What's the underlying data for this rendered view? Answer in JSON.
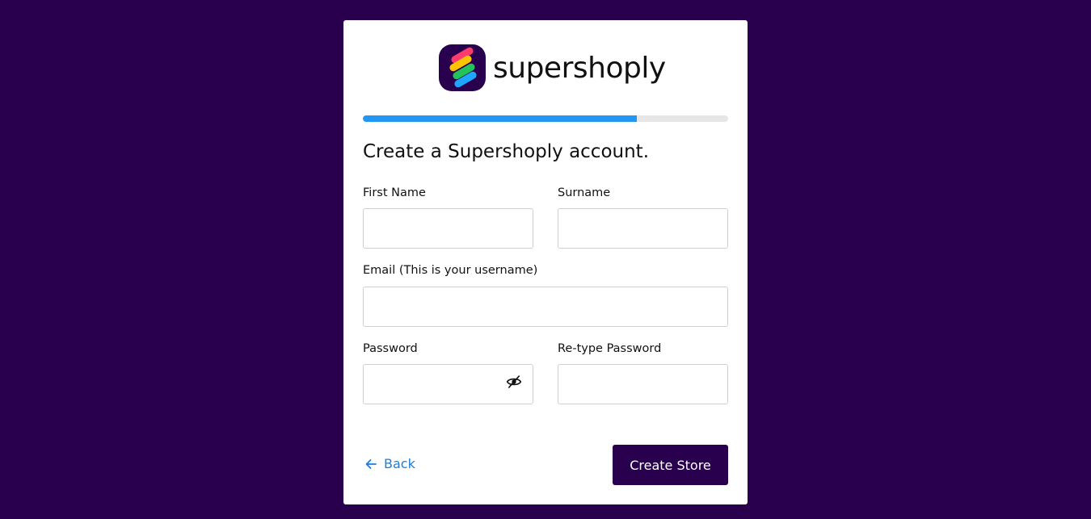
{
  "brand": {
    "name": "supershoply",
    "icon": "supershoply-logo-icon",
    "mark_color": "#28004d",
    "stripe_colors": [
      "#ff3b6b",
      "#ffc400",
      "#21c45a",
      "#1ea7ff"
    ]
  },
  "progress": {
    "fraction": 0.75,
    "fill_color": "#2196f3",
    "track_color": "#e6e6e6"
  },
  "form": {
    "title": "Create a Supershoply account.",
    "first_name": {
      "label": "First Name",
      "value": "",
      "placeholder": ""
    },
    "surname": {
      "label": "Surname",
      "value": "",
      "placeholder": ""
    },
    "email": {
      "label": "Email (This is your username)",
      "value": "",
      "placeholder": ""
    },
    "password": {
      "label": "Password",
      "value": "",
      "placeholder": "",
      "toggle_icon": "eye-slash-icon"
    },
    "retype_password": {
      "label": "Re-type Password",
      "value": "",
      "placeholder": ""
    }
  },
  "actions": {
    "back_label": "Back",
    "back_icon": "arrow-left-icon",
    "submit_label": "Create Store"
  },
  "colors": {
    "page_background": "#28004d",
    "accent": "#1a7fe0",
    "button": "#28004d"
  }
}
